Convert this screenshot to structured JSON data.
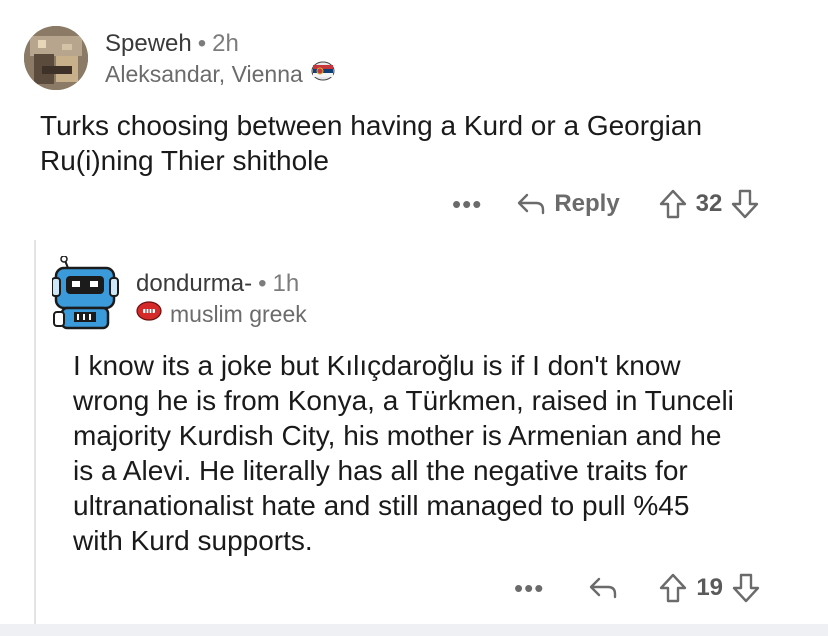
{
  "comments": [
    {
      "author": "Speweh",
      "time": "2h",
      "flair": "Aleksandar, Vienna",
      "body_lines": [
        "Turks choosing between having a Kurd or a Georgian",
        "Ru(i)ning Thier shithole"
      ],
      "reply_label": "Reply",
      "score": "32"
    },
    {
      "author": "dondurma-",
      "time": "1h",
      "flair": "muslim greek",
      "body_lines": [
        "I know its a joke but Kılıçdaroğlu is if I don't know",
        "wrong he is from Konya, a Türkmen, raised in Tunceli",
        "majority Kurdish City, his mother is Armenian and he",
        "is a Alevi. He literally has all the negative traits for",
        "ultranationalist hate and still managed to pull %45",
        "with Kurd supports."
      ],
      "score": "19"
    }
  ],
  "ui": {
    "separator": "•",
    "more": "•••"
  },
  "colors": {
    "text": "#1a1a1b",
    "meta": "#7c7c7c",
    "thread_line": "#e4e4e4",
    "avatar2_bg": "#3b9ad9"
  },
  "icons": {
    "avatar1": "user-avatar-photo",
    "flair1": "serbia-flag-emoji-icon",
    "avatar2": "robot-avatar-icon",
    "flair2": "red-face-emoji-icon",
    "reply": "reply-arrow-icon",
    "upvote": "upvote-arrow-icon",
    "downvote": "downvote-arrow-icon"
  }
}
